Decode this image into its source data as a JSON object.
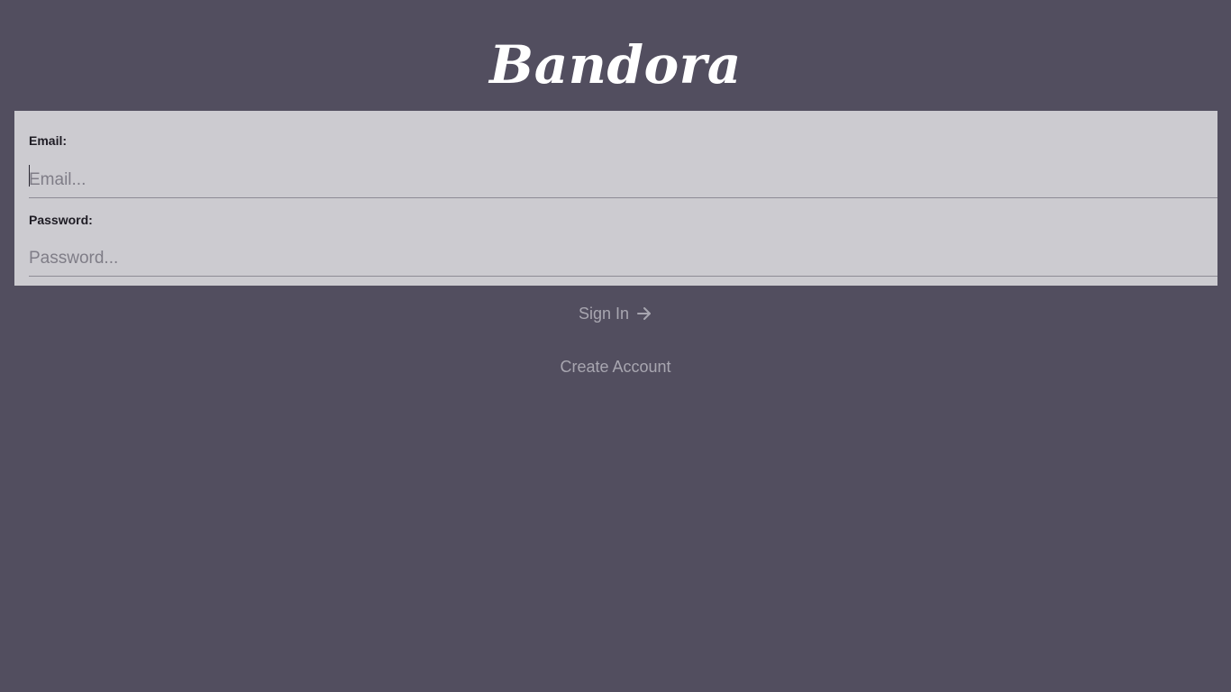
{
  "app": {
    "logo_text": "Bandora"
  },
  "login_form": {
    "email": {
      "label": "Email:",
      "value": "",
      "placeholder": "Email..."
    },
    "password": {
      "label": "Password:",
      "value": "",
      "placeholder": "Password..."
    }
  },
  "actions": {
    "sign_in_label": "Sign In",
    "sign_in_icon": "arrow-right-icon",
    "create_account_label": "Create Account"
  },
  "colors": {
    "background": "#524e5f",
    "panel": "#cccbd0",
    "link_text": "#a8a6b0",
    "logo_text": "#ffffff"
  }
}
